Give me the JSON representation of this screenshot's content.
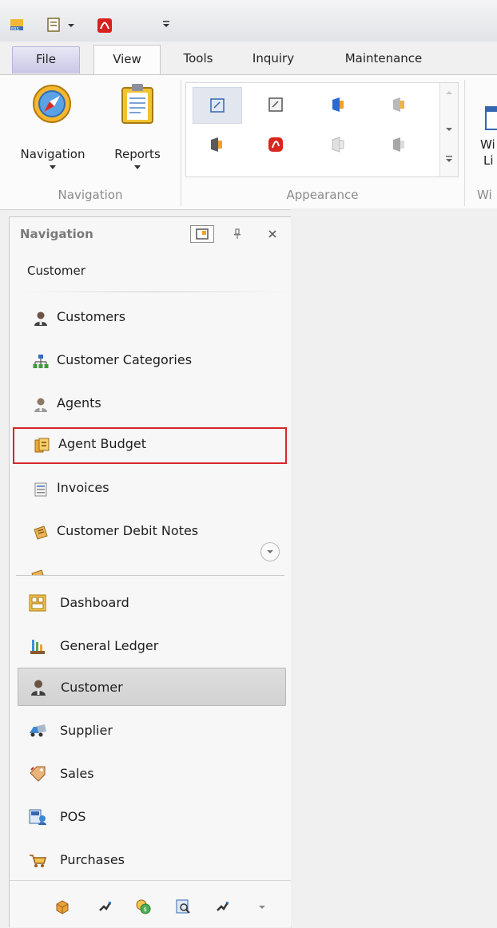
{
  "quick_access": {
    "icons": [
      "app-logo-icon",
      "document-icon",
      "acrobat-icon",
      "customize-icon"
    ]
  },
  "ribbon_tabs": [
    {
      "label": "File"
    },
    {
      "label": "View"
    },
    {
      "label": "Tools"
    },
    {
      "label": "Inquiry"
    },
    {
      "label": "Maintenance"
    }
  ],
  "ribbon": {
    "navigation_group": {
      "label": "Navigation",
      "buttons": [
        {
          "label": "Navigation",
          "icon": "compass-icon"
        },
        {
          "label": "Reports",
          "icon": "clipboard-icon"
        }
      ]
    },
    "appearance_group": {
      "label": "Appearance"
    },
    "window_group": {
      "label": "Wi",
      "button_label_1": "Wi",
      "button_label_2": "Li"
    }
  },
  "nav_panel": {
    "title": "Navigation",
    "group_title": "Customer",
    "items": [
      {
        "label": "Customers",
        "icon": "customer-person-icon"
      },
      {
        "label": "Customer Categories",
        "icon": "hierarchy-icon"
      },
      {
        "label": "Agents",
        "icon": "agent-person-icon"
      },
      {
        "label": "Agent Budget",
        "icon": "budget-icon"
      },
      {
        "label": "Invoices",
        "icon": "invoice-icon"
      },
      {
        "label": "Customer Debit Notes",
        "icon": "debit-note-icon"
      }
    ],
    "modules": [
      {
        "label": "Dashboard",
        "icon": "dashboard-icon"
      },
      {
        "label": "General Ledger",
        "icon": "ledger-icon"
      },
      {
        "label": "Customer",
        "icon": "customer-person-icon"
      },
      {
        "label": "Supplier",
        "icon": "truck-icon"
      },
      {
        "label": "Sales",
        "icon": "sales-tag-icon"
      },
      {
        "label": "POS",
        "icon": "pos-icon"
      },
      {
        "label": "Purchases",
        "icon": "cart-icon"
      }
    ],
    "selected_module": "Customer",
    "highlighted_item": "Agent Budget"
  },
  "colors": {
    "highlight_border": "#d7262b",
    "selected_module_bg": "#d8d8d8"
  }
}
